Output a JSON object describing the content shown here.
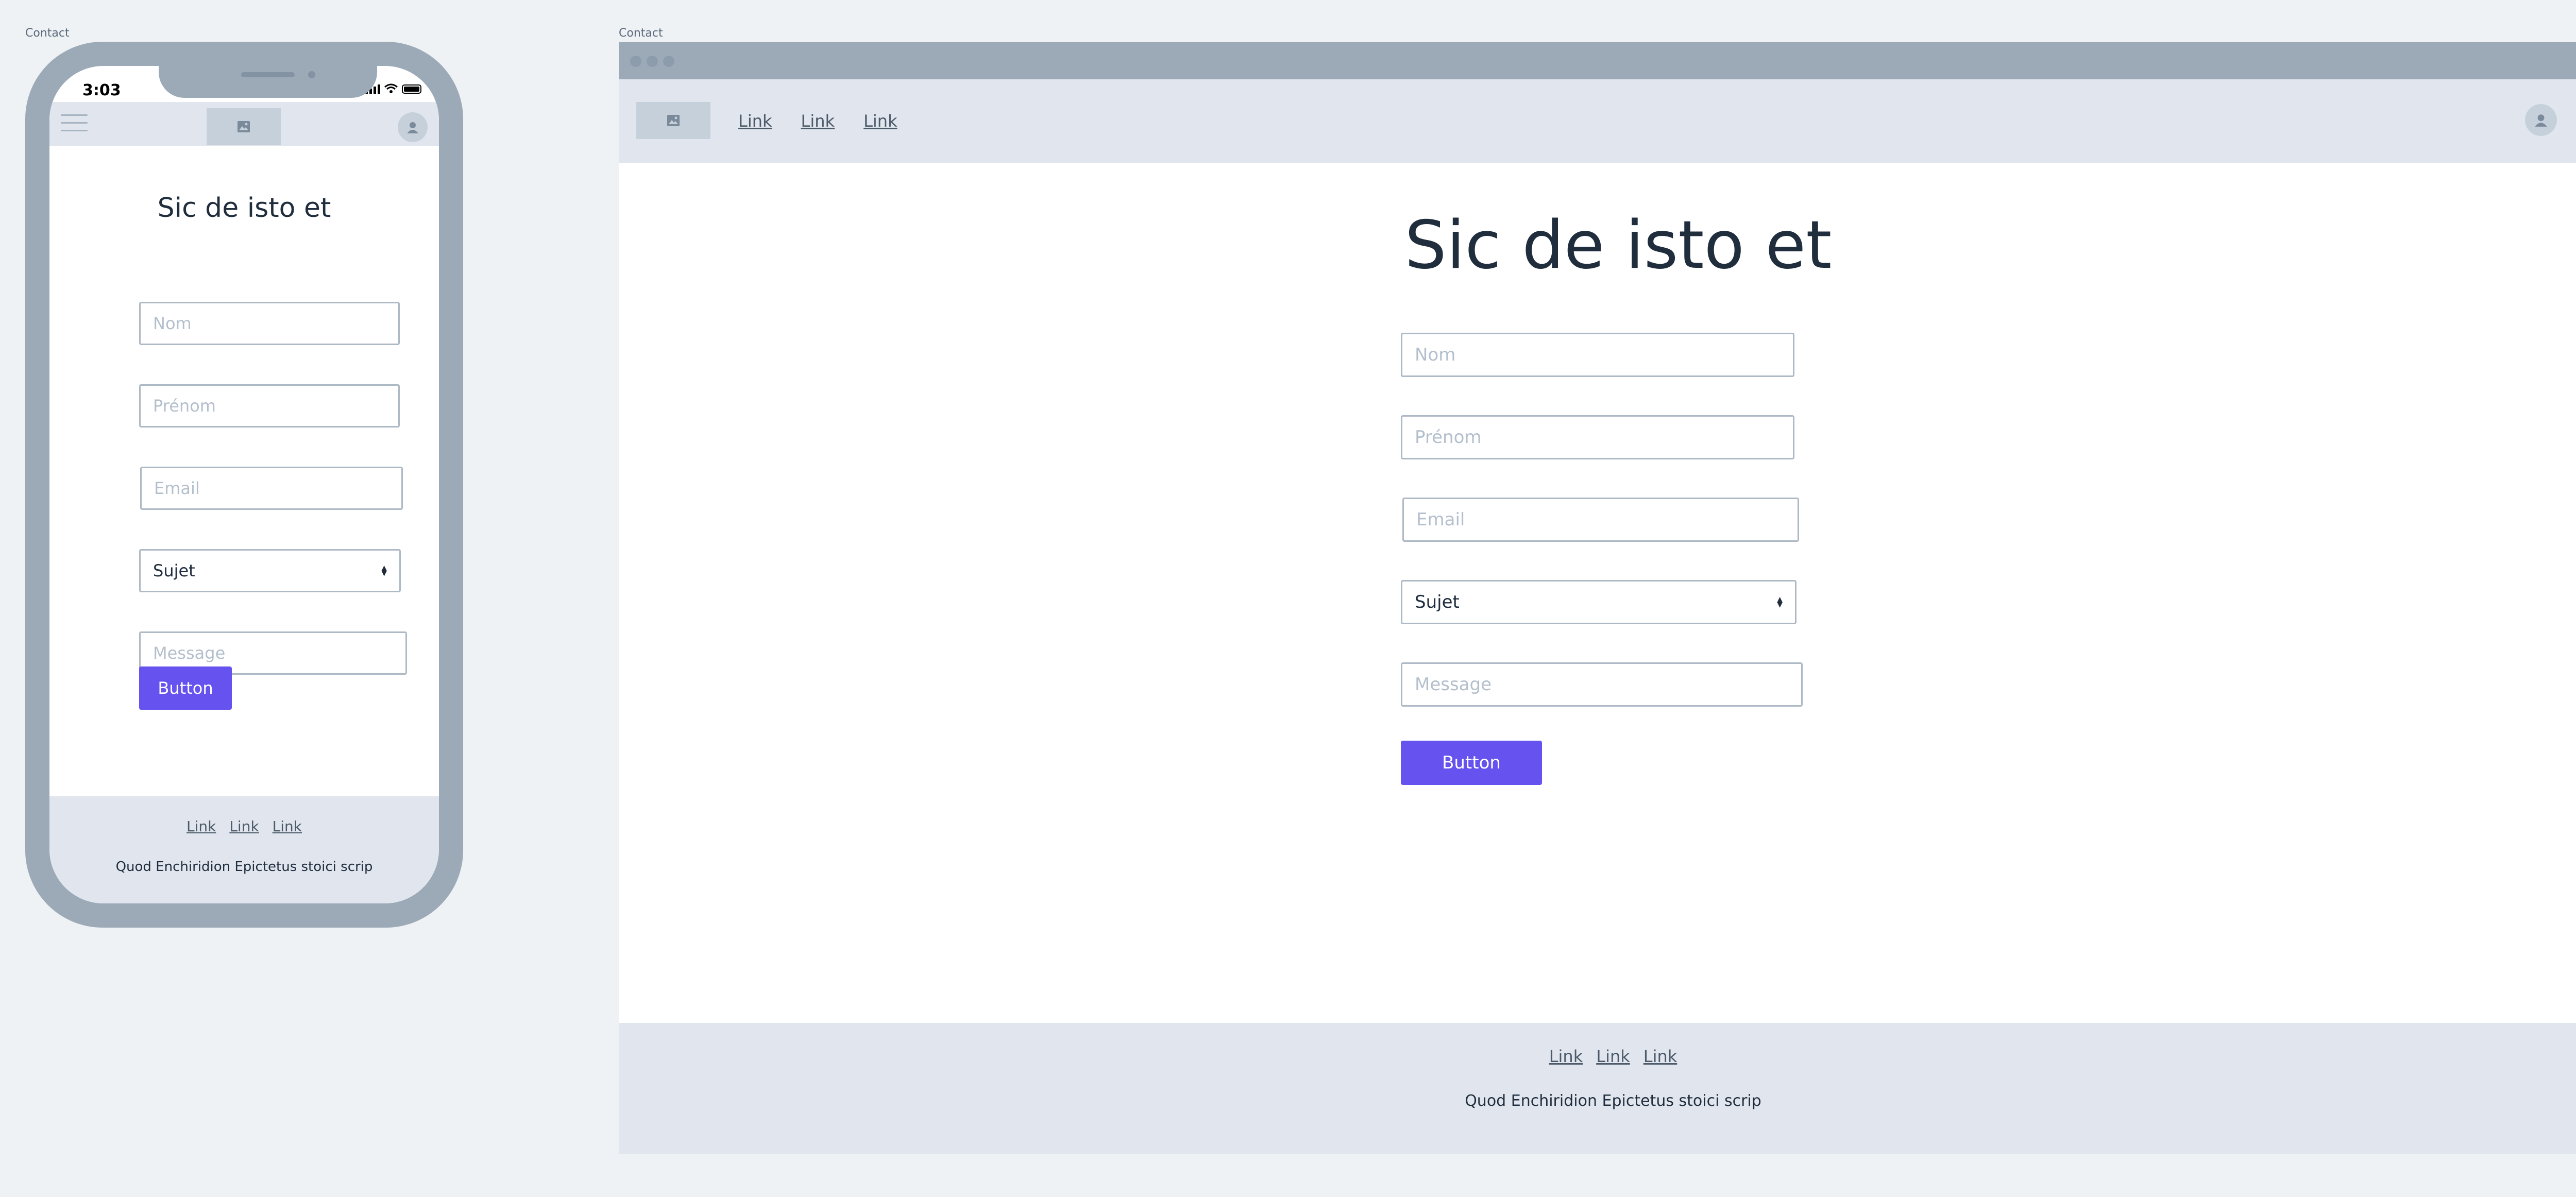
{
  "artboards": {
    "mobile_label": "Contact",
    "desktop_label": "Contact"
  },
  "mobile": {
    "status_time": "3:03",
    "title": "Sic de isto et",
    "form": {
      "nom_placeholder": "Nom",
      "prenom_placeholder": "Prénom",
      "email_placeholder": "Email",
      "subject_value": "Sujet",
      "message_placeholder": "Message",
      "button_label": "Button"
    },
    "footer": {
      "links": [
        "Link",
        "Link",
        "Link"
      ],
      "text": "Quod Enchiridion Epictetus stoici scrip"
    }
  },
  "desktop": {
    "nav_links": [
      "Link",
      "Link",
      "Link"
    ],
    "title": "Sic de isto et",
    "form": {
      "nom_placeholder": "Nom",
      "prenom_placeholder": "Prénom",
      "email_placeholder": "Email",
      "subject_value": "Sujet",
      "message_placeholder": "Message",
      "button_label": "Button"
    },
    "footer": {
      "links": [
        "Link",
        "Link",
        "Link"
      ],
      "text": "Quod Enchiridion Epictetus stoici scrip"
    }
  },
  "colors": {
    "page_bg": "#eff2f5",
    "device_frame": "#9caab8",
    "nav_bg": "#e1e6ee",
    "placeholder_block": "#c6d0db",
    "button_accent": "#6653ef",
    "text": "#1f2d3d"
  },
  "icons": {
    "menu": "hamburger-icon",
    "logo": "image-placeholder-icon",
    "avatar": "user-icon",
    "select": "updown-chevron-icon"
  }
}
